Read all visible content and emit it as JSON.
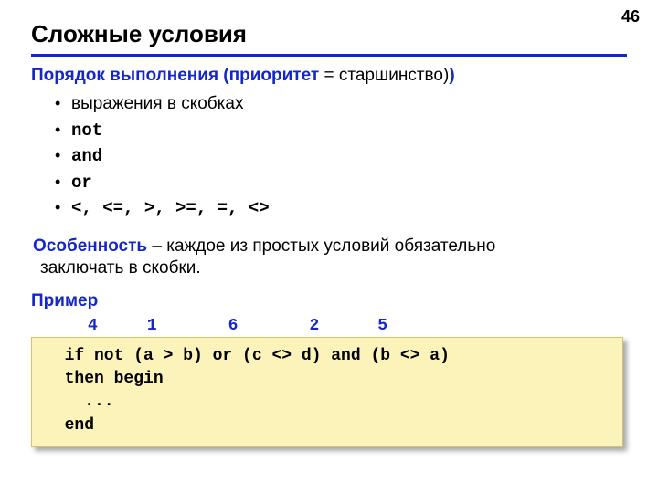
{
  "page_number": "46",
  "title": "Сложные условия",
  "order": {
    "heading_lead": "Порядок выполнения (приоритет",
    "heading_suffix": " = старшинство)",
    "bullets": {
      "b0": "выражения в скобках",
      "b1": "not",
      "b2": "and",
      "b3": "or",
      "b4": "<, <=, >, >=, =, <>"
    }
  },
  "feature": {
    "lead": "Особенность",
    "dash": " – ",
    "text1": "каждое из простых условий обязательно",
    "text2": "заключать в скобки."
  },
  "example": {
    "label": "Пример",
    "digits": {
      "n1": "4",
      "n2": "1",
      "n3": "6",
      "n4": "2",
      "n5": "5"
    },
    "code": "  if not (a > b) or (c <> d) and (b <> a)\n  then begin\n    ...\n  end"
  }
}
